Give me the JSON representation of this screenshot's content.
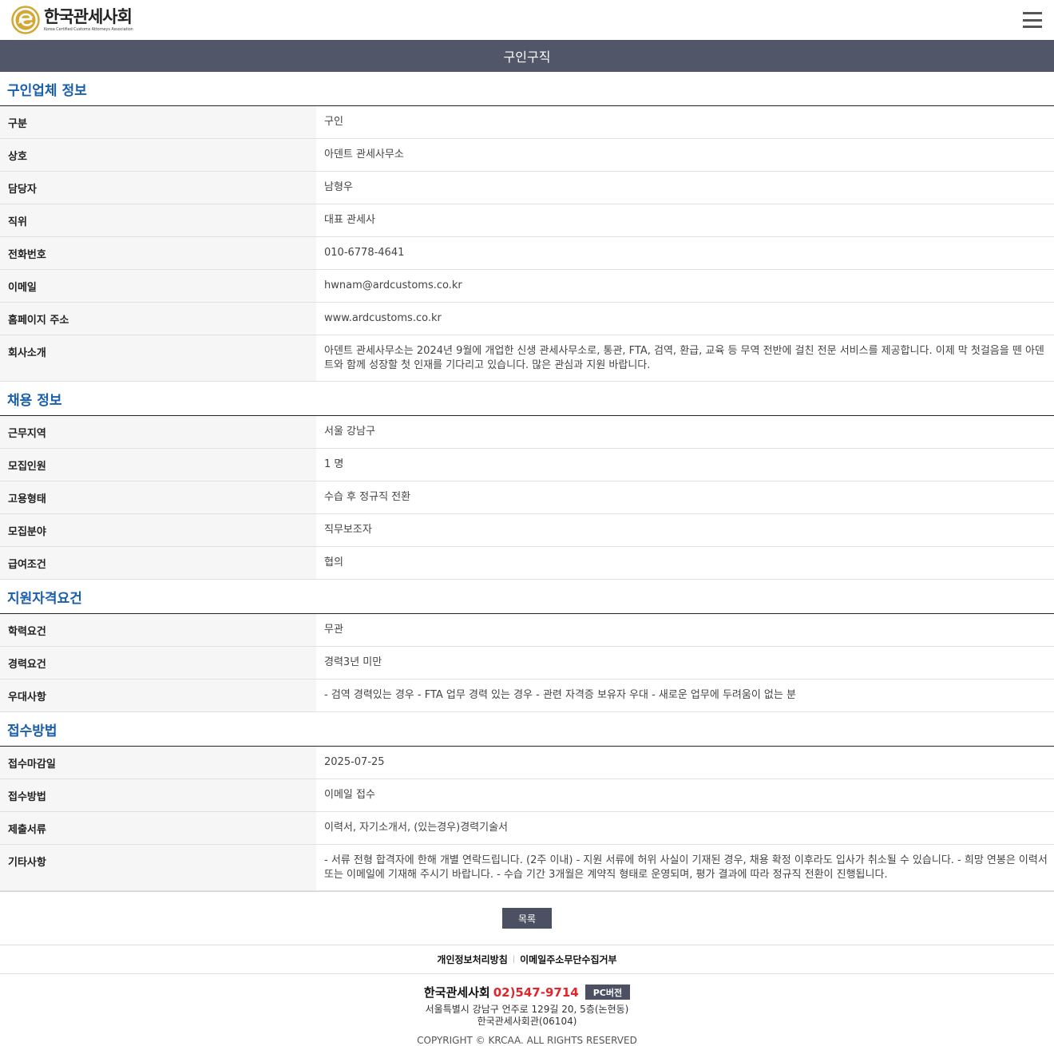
{
  "header": {
    "logo_ko": "한국관세사회",
    "logo_en": "Korea Certified Customs Attorneys Association",
    "menu_icon": "hamburger-icon"
  },
  "page_title": "구인구직",
  "sections": [
    {
      "title": "구인업체 정보",
      "rows": [
        {
          "label": "구분",
          "value": "구인"
        },
        {
          "label": "상호",
          "value": "아덴트 관세사무소"
        },
        {
          "label": "담당자",
          "value": "남형우"
        },
        {
          "label": "직위",
          "value": "대표 관세사"
        },
        {
          "label": "전화번호",
          "value": "010-6778-4641"
        },
        {
          "label": "이메일",
          "value": "hwnam@ardcustoms.co.kr"
        },
        {
          "label": "홈페이지 주소",
          "value": "www.ardcustoms.co.kr"
        },
        {
          "label": "회사소개",
          "value": "아덴트 관세사무소는 2024년 9월에 개업한 신생 관세사무소로, 통관, FTA, 검역, 환급, 교육 등 무역 전반에 걸친 전문 서비스를 제공합니다. 이제 막 첫걸음을 뗀 아덴트와 함께 성장할 첫 인재를 기다리고 있습니다. 많은 관심과 지원 바랍니다."
        }
      ]
    },
    {
      "title": "채용 정보",
      "rows": [
        {
          "label": "근무지역",
          "value": "서울 강남구"
        },
        {
          "label": "모집인원",
          "value": "1 명"
        },
        {
          "label": "고용형태",
          "value": "수습 후 정규직 전환"
        },
        {
          "label": "모집분야",
          "value": "직무보조자"
        },
        {
          "label": "급여조건",
          "value": "협의"
        }
      ]
    },
    {
      "title": "지원자격요건",
      "rows": [
        {
          "label": "학력요건",
          "value": "무관"
        },
        {
          "label": "경력요건",
          "value": "경력3년 미만"
        },
        {
          "label": "우대사항",
          "value": "- 검역 경력있는 경우 - FTA 업무 경력 있는 경우 - 관련 자격증 보유자 우대 - 새로운 업무에 두려움이 없는 분"
        }
      ]
    },
    {
      "title": "접수방법",
      "rows": [
        {
          "label": "접수마감일",
          "value": "2025-07-25"
        },
        {
          "label": "접수방법",
          "value": "이메일 접수"
        },
        {
          "label": "제출서류",
          "value": "이력서, 자기소개서, (있는경우)경력기술서"
        },
        {
          "label": "기타사항",
          "value": "- 서류 전형 합격자에 한해 개별 연락드립니다. (2주 이내) - 지원 서류에 허위 사실이 기재된 경우, 채용 확정 이후라도 입사가 취소될 수 있습니다. - 희망 연봉은 이력서 또는 이메일에 기재해 주시기 바랍니다. - 수습 기간 3개월은 계약직 형태로 운영되며, 평가 결과에 따라 정규직 전환이 진행됩니다."
        }
      ]
    }
  ],
  "list_button": "목록",
  "footer": {
    "links": [
      "개인정보처리방침",
      "이메일주소무단수집거부"
    ],
    "org_name": "한국관세사회",
    "phone": "02)547-9714",
    "pc_button": "PC버전",
    "address_line1": "서울특별시 강남구 언주로 129길 20, 5층(논현동)",
    "address_line2": "한국관세사회관(06104)",
    "copyright": "COPYRIGHT © KRCAA. ALL RIGHTS RESERVED"
  },
  "colors": {
    "title_bar": "#515669",
    "section_title": "#1a5fab",
    "phone": "#e0262c",
    "logo_gold": "#d4a732"
  }
}
